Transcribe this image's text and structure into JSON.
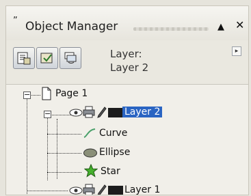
{
  "window": {
    "title": "Object Manager",
    "grip_glyph": "”",
    "up_button": "▲",
    "close_button": "✕"
  },
  "toolbar": {
    "layer_label_line1": "Layer:",
    "layer_label_line2": "Layer 2",
    "flyout_button": "▸"
  },
  "tree": {
    "page": {
      "label": "Page 1",
      "expander": "−"
    },
    "layer2": {
      "label": "Layer 2",
      "expander": "−",
      "color": "#1c1c1c"
    },
    "children": [
      {
        "label": "Curve"
      },
      {
        "label": "Ellipse"
      },
      {
        "label": "Star"
      }
    ],
    "layer1": {
      "label": "Layer 1",
      "color": "#1c1c1c"
    }
  },
  "colors": {
    "selection": "#2a64c2",
    "star_fill": "#46b02d",
    "curve_stroke": "#4aa06a",
    "ellipse_fill": "#8a8f78"
  }
}
